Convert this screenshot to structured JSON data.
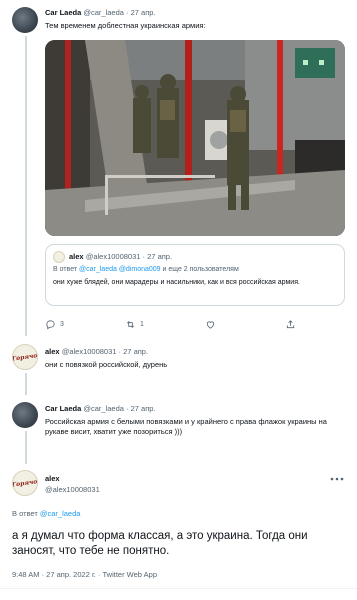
{
  "tweet1": {
    "name": "Car Laeda",
    "handle": "@car_laeda",
    "sep": "·",
    "date": "27 апр.",
    "text": "Тем временем доблестная украинская армия:",
    "quote": {
      "name": "alex",
      "handle": "@alex10008031",
      "sep": "·",
      "date": "27 апр.",
      "reply_prefix": "В ответ",
      "reply_users": "@car_laeda @dimona009",
      "reply_suffix": "и еще 2 пользователям",
      "text": "они хуже блядей, они марадеры и насильники, как и вся российская армия."
    },
    "actions": {
      "replies": "3",
      "retweets": "1",
      "likes": ""
    }
  },
  "tweet2": {
    "avatar_text": "Горячо",
    "name": "alex",
    "handle": "@alex10008031",
    "sep": "·",
    "date": "27 апр.",
    "text": "они с повязкой российской, дурень"
  },
  "tweet3": {
    "name": "Car Laeda",
    "handle": "@car_laeda",
    "sep": "·",
    "date": "27 апр.",
    "text": "Российская армия с белыми повязками и у крайнего с права флажок украины на рукаве висит, хватит уже позориться )))"
  },
  "main": {
    "avatar_text": "Горячо",
    "name": "alex",
    "handle": "@alex10008031",
    "reply_prefix": "В ответ",
    "reply_user": "@car_laeda",
    "text": "а я думал что форма классая, а это украина. Тогда они заносят, что тебе не понятно.",
    "time": "9:48 AM · 27 апр. 2022 г. · Twitter Web App"
  },
  "colors": {
    "accent": "#1d9bf0",
    "muted": "#536471",
    "border": "#cfd9de"
  },
  "icons": [
    "reply-icon",
    "retweet-icon",
    "like-icon",
    "share-icon",
    "more-icon"
  ]
}
